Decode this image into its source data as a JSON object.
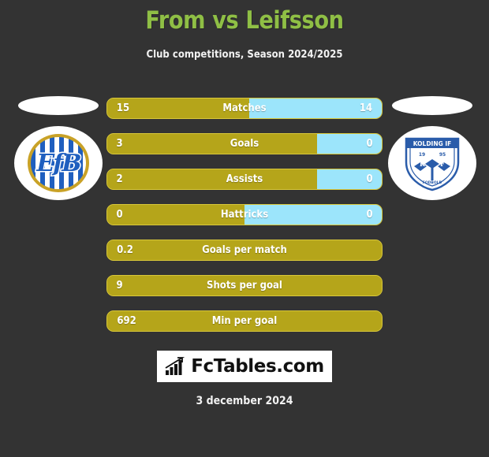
{
  "header": {
    "title": "From vs Leifsson",
    "subtitle": "Club competitions, Season 2024/2025",
    "title_color": "#8fbf45"
  },
  "teams": {
    "home": {
      "crest_name": "EfB",
      "crest_text": "EfB"
    },
    "away": {
      "crest_name": "Kolding IF",
      "crest_top_text": "KOLDING IF",
      "crest_year_left": "19",
      "crest_year_right": "95",
      "crest_mono_left": "K",
      "crest_mono_right": "F",
      "crest_bottom_text": "FODBOLD"
    }
  },
  "colors": {
    "background": "#333333",
    "home_bar": "#b5a51a",
    "away_bar": "#9ce5fb",
    "bar_border": "#d8c73a",
    "text": "#ffffff"
  },
  "stats": [
    {
      "label": "Matches",
      "home": "15",
      "away": "14",
      "home_pct": 51.7,
      "split": true
    },
    {
      "label": "Goals",
      "home": "3",
      "away": "0",
      "home_pct": 76.3,
      "split": true
    },
    {
      "label": "Assists",
      "home": "2",
      "away": "0",
      "home_pct": 76.3,
      "split": true
    },
    {
      "label": "Hattricks",
      "home": "0",
      "away": "0",
      "home_pct": 50.0,
      "split": true
    },
    {
      "label": "Goals per match",
      "home": "0.2",
      "away": "",
      "home_pct": 100,
      "split": false
    },
    {
      "label": "Shots per goal",
      "home": "9",
      "away": "",
      "home_pct": 100,
      "split": false
    },
    {
      "label": "Min per goal",
      "home": "692",
      "away": "",
      "home_pct": 100,
      "split": false
    }
  ],
  "footer": {
    "logo_text": "FcTables.com",
    "logo_icon": "bar-chart-icon",
    "date": "3 december 2024"
  },
  "chart_data": {
    "type": "bar",
    "title": "From vs Leifsson",
    "subtitle": "Club competitions, Season 2024/2025",
    "categories": [
      "Matches",
      "Goals",
      "Assists",
      "Hattricks",
      "Goals per match",
      "Shots per goal",
      "Min per goal"
    ],
    "series": [
      {
        "name": "From",
        "values": [
          15,
          3,
          2,
          0,
          0.2,
          9,
          692
        ]
      },
      {
        "name": "Leifsson",
        "values": [
          14,
          0,
          0,
          0,
          null,
          null,
          null
        ]
      }
    ],
    "orientation": "horizontal-paired",
    "legend": "none",
    "grid": false
  }
}
